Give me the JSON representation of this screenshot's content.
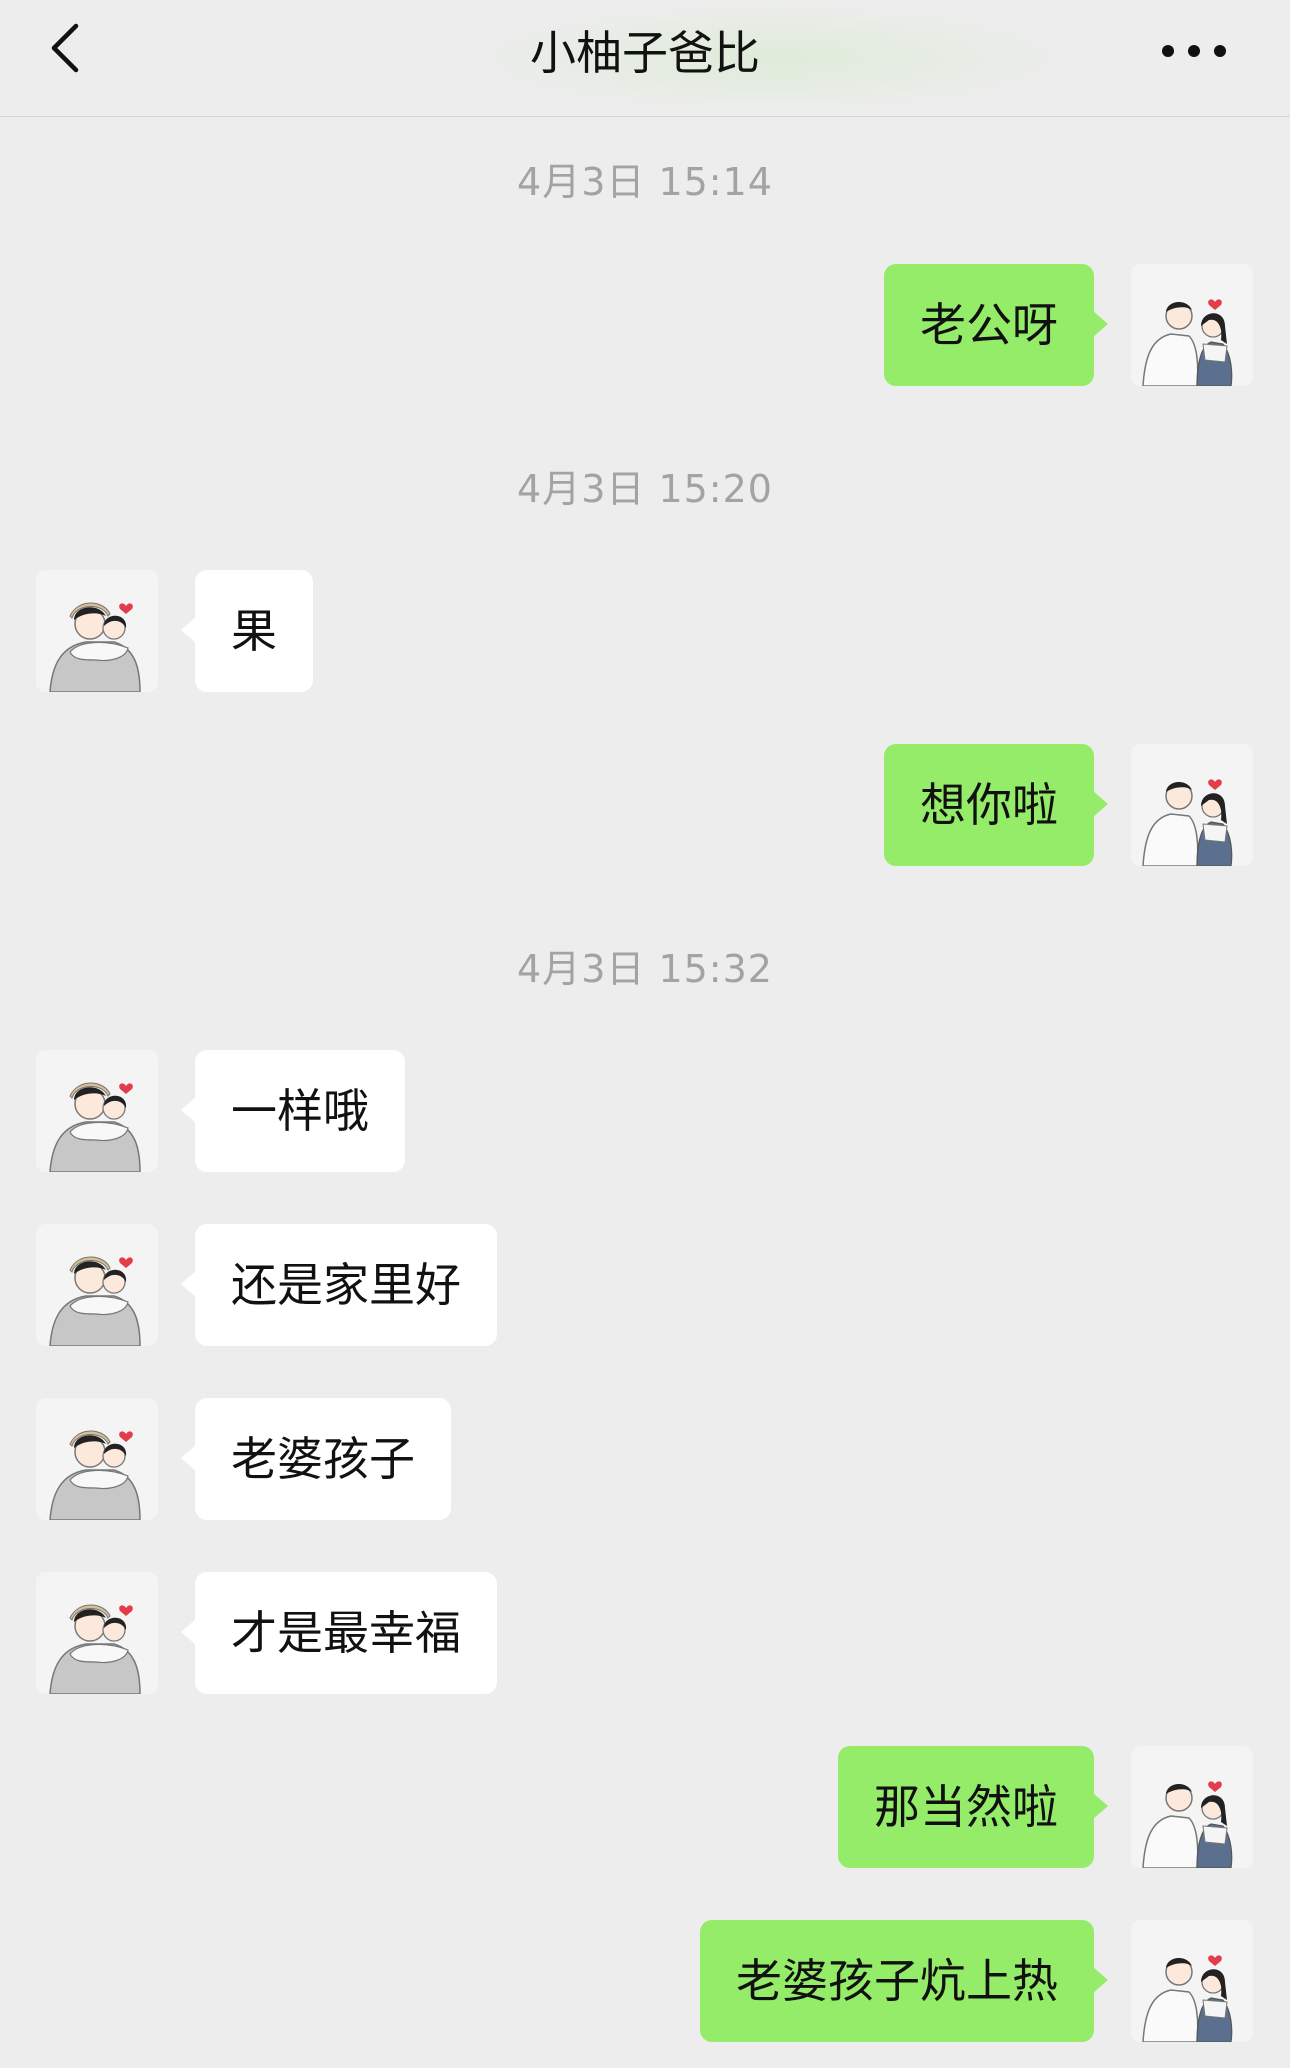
{
  "header": {
    "title": "小柚子爸比",
    "back_icon": "chevron-left-icon",
    "more_icon": "more-dots-icon"
  },
  "colors": {
    "background": "#ededed",
    "self_bubble": "#95ec69",
    "other_bubble": "#ffffff",
    "timestamp_text": "#a3a3a3"
  },
  "timestamps": [
    "4月3日 15:14",
    "4月3日 15:20",
    "4月3日 15:32"
  ],
  "messages": [
    {
      "sender": "self",
      "text": "老公呀"
    },
    {
      "sender": "other",
      "text": "果"
    },
    {
      "sender": "self",
      "text": "想你啦"
    },
    {
      "sender": "other",
      "text": "一样哦"
    },
    {
      "sender": "other",
      "text": "还是家里好"
    },
    {
      "sender": "other",
      "text": "老婆孩子"
    },
    {
      "sender": "other",
      "text": "才是最幸福"
    },
    {
      "sender": "self",
      "text": "那当然啦"
    },
    {
      "sender": "self",
      "text": "老婆孩子炕上热"
    }
  ]
}
